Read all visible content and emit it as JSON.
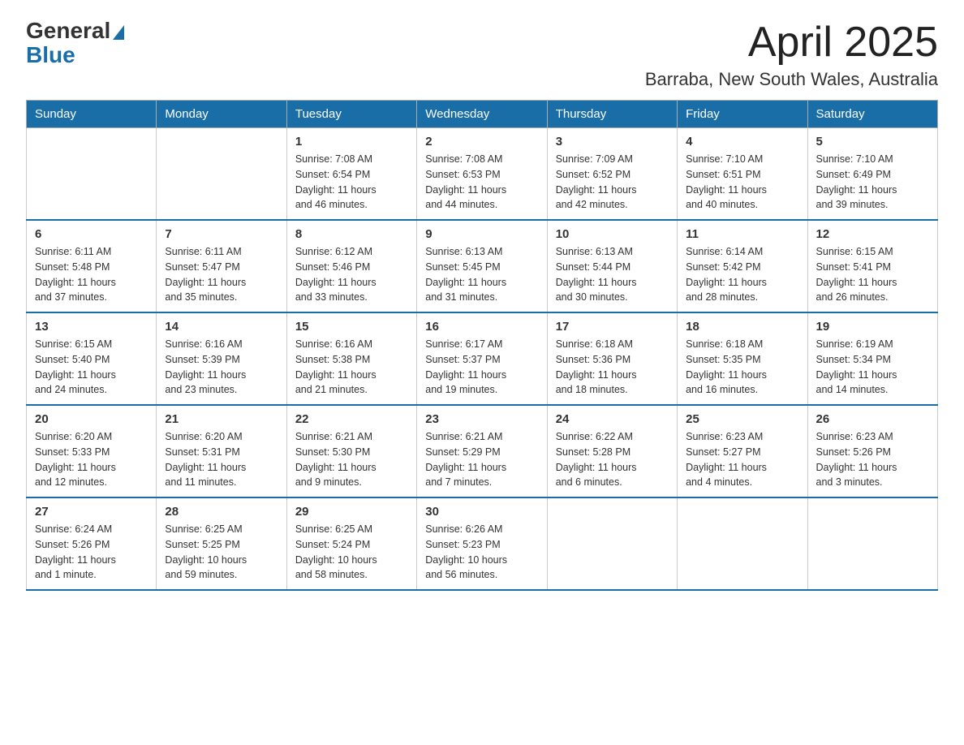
{
  "logo": {
    "general": "General",
    "blue": "Blue"
  },
  "title": "April 2025",
  "subtitle": "Barraba, New South Wales, Australia",
  "days_header": [
    "Sunday",
    "Monday",
    "Tuesday",
    "Wednesday",
    "Thursday",
    "Friday",
    "Saturday"
  ],
  "weeks": [
    [
      {
        "day": "",
        "info": ""
      },
      {
        "day": "",
        "info": ""
      },
      {
        "day": "1",
        "info": "Sunrise: 7:08 AM\nSunset: 6:54 PM\nDaylight: 11 hours\nand 46 minutes."
      },
      {
        "day": "2",
        "info": "Sunrise: 7:08 AM\nSunset: 6:53 PM\nDaylight: 11 hours\nand 44 minutes."
      },
      {
        "day": "3",
        "info": "Sunrise: 7:09 AM\nSunset: 6:52 PM\nDaylight: 11 hours\nand 42 minutes."
      },
      {
        "day": "4",
        "info": "Sunrise: 7:10 AM\nSunset: 6:51 PM\nDaylight: 11 hours\nand 40 minutes."
      },
      {
        "day": "5",
        "info": "Sunrise: 7:10 AM\nSunset: 6:49 PM\nDaylight: 11 hours\nand 39 minutes."
      }
    ],
    [
      {
        "day": "6",
        "info": "Sunrise: 6:11 AM\nSunset: 5:48 PM\nDaylight: 11 hours\nand 37 minutes."
      },
      {
        "day": "7",
        "info": "Sunrise: 6:11 AM\nSunset: 5:47 PM\nDaylight: 11 hours\nand 35 minutes."
      },
      {
        "day": "8",
        "info": "Sunrise: 6:12 AM\nSunset: 5:46 PM\nDaylight: 11 hours\nand 33 minutes."
      },
      {
        "day": "9",
        "info": "Sunrise: 6:13 AM\nSunset: 5:45 PM\nDaylight: 11 hours\nand 31 minutes."
      },
      {
        "day": "10",
        "info": "Sunrise: 6:13 AM\nSunset: 5:44 PM\nDaylight: 11 hours\nand 30 minutes."
      },
      {
        "day": "11",
        "info": "Sunrise: 6:14 AM\nSunset: 5:42 PM\nDaylight: 11 hours\nand 28 minutes."
      },
      {
        "day": "12",
        "info": "Sunrise: 6:15 AM\nSunset: 5:41 PM\nDaylight: 11 hours\nand 26 minutes."
      }
    ],
    [
      {
        "day": "13",
        "info": "Sunrise: 6:15 AM\nSunset: 5:40 PM\nDaylight: 11 hours\nand 24 minutes."
      },
      {
        "day": "14",
        "info": "Sunrise: 6:16 AM\nSunset: 5:39 PM\nDaylight: 11 hours\nand 23 minutes."
      },
      {
        "day": "15",
        "info": "Sunrise: 6:16 AM\nSunset: 5:38 PM\nDaylight: 11 hours\nand 21 minutes."
      },
      {
        "day": "16",
        "info": "Sunrise: 6:17 AM\nSunset: 5:37 PM\nDaylight: 11 hours\nand 19 minutes."
      },
      {
        "day": "17",
        "info": "Sunrise: 6:18 AM\nSunset: 5:36 PM\nDaylight: 11 hours\nand 18 minutes."
      },
      {
        "day": "18",
        "info": "Sunrise: 6:18 AM\nSunset: 5:35 PM\nDaylight: 11 hours\nand 16 minutes."
      },
      {
        "day": "19",
        "info": "Sunrise: 6:19 AM\nSunset: 5:34 PM\nDaylight: 11 hours\nand 14 minutes."
      }
    ],
    [
      {
        "day": "20",
        "info": "Sunrise: 6:20 AM\nSunset: 5:33 PM\nDaylight: 11 hours\nand 12 minutes."
      },
      {
        "day": "21",
        "info": "Sunrise: 6:20 AM\nSunset: 5:31 PM\nDaylight: 11 hours\nand 11 minutes."
      },
      {
        "day": "22",
        "info": "Sunrise: 6:21 AM\nSunset: 5:30 PM\nDaylight: 11 hours\nand 9 minutes."
      },
      {
        "day": "23",
        "info": "Sunrise: 6:21 AM\nSunset: 5:29 PM\nDaylight: 11 hours\nand 7 minutes."
      },
      {
        "day": "24",
        "info": "Sunrise: 6:22 AM\nSunset: 5:28 PM\nDaylight: 11 hours\nand 6 minutes."
      },
      {
        "day": "25",
        "info": "Sunrise: 6:23 AM\nSunset: 5:27 PM\nDaylight: 11 hours\nand 4 minutes."
      },
      {
        "day": "26",
        "info": "Sunrise: 6:23 AM\nSunset: 5:26 PM\nDaylight: 11 hours\nand 3 minutes."
      }
    ],
    [
      {
        "day": "27",
        "info": "Sunrise: 6:24 AM\nSunset: 5:26 PM\nDaylight: 11 hours\nand 1 minute."
      },
      {
        "day": "28",
        "info": "Sunrise: 6:25 AM\nSunset: 5:25 PM\nDaylight: 10 hours\nand 59 minutes."
      },
      {
        "day": "29",
        "info": "Sunrise: 6:25 AM\nSunset: 5:24 PM\nDaylight: 10 hours\nand 58 minutes."
      },
      {
        "day": "30",
        "info": "Sunrise: 6:26 AM\nSunset: 5:23 PM\nDaylight: 10 hours\nand 56 minutes."
      },
      {
        "day": "",
        "info": ""
      },
      {
        "day": "",
        "info": ""
      },
      {
        "day": "",
        "info": ""
      }
    ]
  ]
}
